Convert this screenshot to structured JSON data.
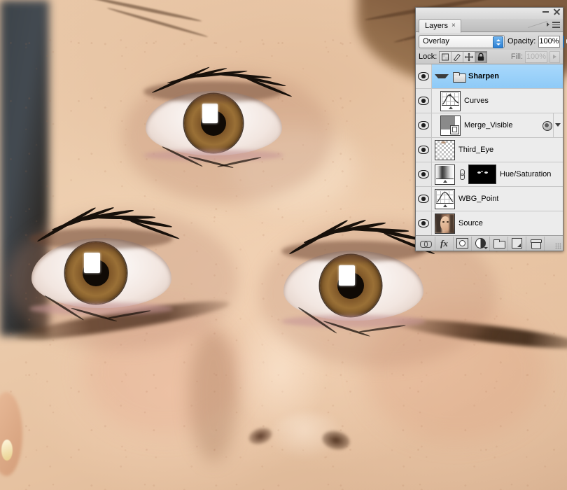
{
  "window": {
    "minimize_label": "Minimize",
    "close_label": "Close",
    "panel_menu_label": "Panel menu"
  },
  "panel": {
    "tab_label": "Layers",
    "tab_close": "×",
    "blend_mode": "Overlay",
    "opacity_label": "Opacity:",
    "opacity_value": "100%",
    "lock_label": "Lock:",
    "lock_buttons": [
      {
        "name": "lock-transparent-pixels",
        "active": false
      },
      {
        "name": "lock-image-pixels",
        "active": false
      },
      {
        "name": "lock-position",
        "active": false
      },
      {
        "name": "lock-all",
        "active": true
      }
    ],
    "fill_label": "Fill:",
    "fill_value": "100%",
    "accent_color": "#2b7fd4",
    "selection_color": "#8ecaf7"
  },
  "layers": [
    {
      "name": "Sharpen",
      "kind": "group",
      "visible": true,
      "selected": true,
      "expanded": true,
      "indent": 0,
      "thumb": "folder"
    },
    {
      "name": "Curves",
      "kind": "adjustment",
      "visible": true,
      "selected": false,
      "indent": 1,
      "thumb": "curves-thumbnail"
    },
    {
      "name": "Merge_Visible",
      "kind": "smart-object",
      "visible": true,
      "selected": false,
      "indent": 1,
      "thumb": "smart-object-thumbnail",
      "has_effects": true,
      "has_disclosure": true
    },
    {
      "name": "Third_Eye",
      "kind": "pixel",
      "visible": true,
      "selected": false,
      "indent": 0,
      "thumb": "transparent-thumbnail"
    },
    {
      "name": "Hue/Saturation",
      "kind": "adjustment",
      "visible": true,
      "selected": false,
      "indent": 0,
      "thumb": "gradient-thumbnail",
      "linked": true,
      "mask": "layer-mask-thumbnail"
    },
    {
      "name": "WBG_Point",
      "kind": "adjustment",
      "visible": true,
      "selected": false,
      "indent": 0,
      "thumb": "curves-thumbnail"
    },
    {
      "name": "Source",
      "kind": "pixel",
      "visible": true,
      "selected": false,
      "indent": 0,
      "thumb": "photo-thumbnail"
    }
  ],
  "toolbar": [
    {
      "icon": "link-icon",
      "label": "Link layers"
    },
    {
      "icon": "fx-icon",
      "label": "Add a layer style",
      "glyph": "fx"
    },
    {
      "icon": "layer-mask-icon",
      "label": "Add layer mask"
    },
    {
      "icon": "adjustment-layer-icon",
      "label": "Create new fill or adjustment layer"
    },
    {
      "icon": "new-group-icon",
      "label": "Create a new group"
    },
    {
      "icon": "new-layer-icon",
      "label": "Create a new layer"
    },
    {
      "icon": "trash-icon",
      "label": "Delete layer"
    }
  ],
  "canvas": {
    "description": "Close-up portrait of a woman's face with three eyes",
    "subject": "three-eyed portrait"
  }
}
